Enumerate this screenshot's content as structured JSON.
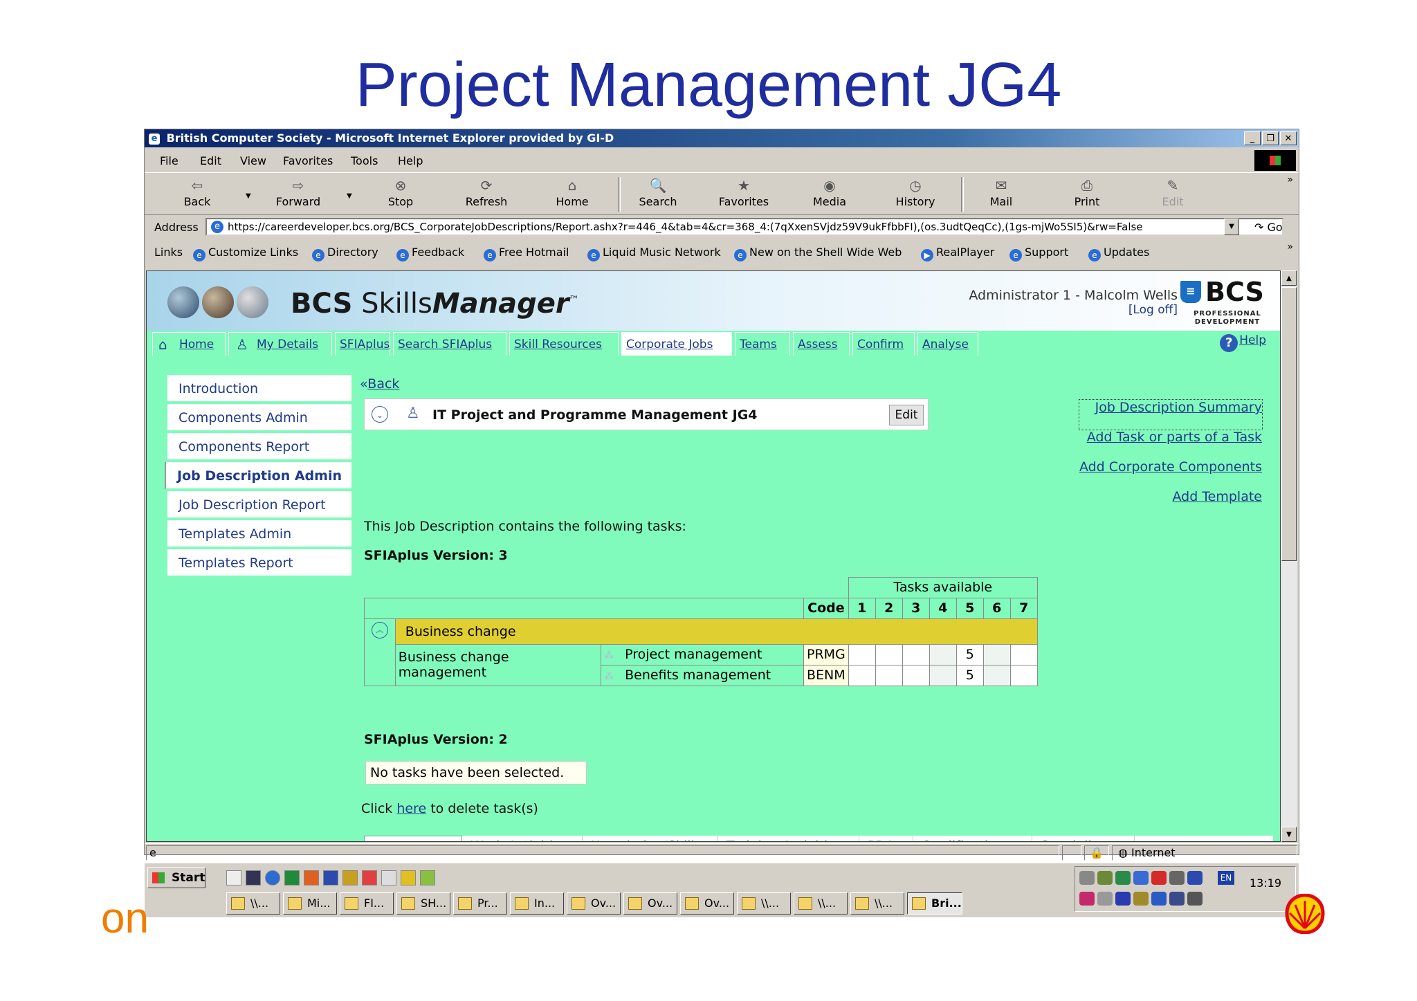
{
  "slide": {
    "title": "Project Management JG4",
    "brand_fragment": "on"
  },
  "window": {
    "title": "British Computer Society - Microsoft Internet Explorer provided by GI-D",
    "menu": [
      "File",
      "Edit",
      "View",
      "Favorites",
      "Tools",
      "Help"
    ],
    "toolbar": {
      "back": "Back",
      "forward": "Forward",
      "stop": "Stop",
      "refresh": "Refresh",
      "home": "Home",
      "search": "Search",
      "favorites": "Favorites",
      "media": "Media",
      "history": "History",
      "mail": "Mail",
      "print": "Print",
      "edit": "Edit"
    },
    "address_label": "Address",
    "address_url": "https://careerdeveloper.bcs.org/BCS_CorporateJobDescriptions/Report.ashx?r=446_4&tab=4&cr=368_4:(7qXxenSVjdz59V9ukFfbbFI),(os.3udtQeqCc),(1gs-mjWo5SI5)&rw=False",
    "go_label": "Go",
    "links_label": "Links",
    "links": [
      "Customize Links",
      "Directory",
      "Feedback",
      "Free Hotmail",
      "Liquid Music Network",
      "New on the Shell Wide Web",
      "RealPlayer",
      "Support",
      "Updates"
    ],
    "status_zone": "Internet"
  },
  "app": {
    "name_bold": "BCS",
    "name_regular": " Skills",
    "name_italic": "Manager",
    "tm": "™",
    "user": "Administrator 1 - Malcolm Wells",
    "logoff": "[Log off]",
    "logo_text": "BCS",
    "logo_subtitle_1": "PROFESSIONAL",
    "logo_subtitle_2": "DEVELOPMENT",
    "nav": [
      "Home",
      "My Details",
      "SFIAplus",
      "Search SFIAplus",
      "Skill Resources",
      "Corporate Jobs",
      "Teams",
      "Assess",
      "Confirm",
      "Analyse"
    ],
    "help": "Help",
    "sidemenu": [
      "Introduction",
      "Components Admin",
      "Components Report",
      "Job Description Admin",
      "Job Description Report",
      "Templates Admin",
      "Templates Report"
    ],
    "back": "Back",
    "jd_title": "IT Project and Programme Management JG4",
    "edit": "Edit",
    "right_links": [
      "Job Description Summary",
      "Add Task or parts of a Task",
      "Add Corporate Components",
      "Add Template"
    ],
    "intro_text": "This Job Description contains the following tasks:",
    "version3_label": "SFIAplus Version: 3",
    "version2_label": "SFIAplus Version: 2",
    "no_tasks": "No tasks have been selected.",
    "delete_prefix": "Click ",
    "delete_link": "here",
    "delete_suffix": " to delete task(s)",
    "bottom_tabs": [
      "Background",
      "Work Activities",
      "Knowledge/Skills",
      "Training Activities",
      "PDAs",
      "Qualifications",
      "Specialisms"
    ]
  },
  "task_table": {
    "tasks_available_label": "Tasks available",
    "code_label": "Code",
    "levels": [
      "1",
      "2",
      "3",
      "4",
      "5",
      "6",
      "7"
    ],
    "category": "Business change",
    "subcategory": "Business change management",
    "rows": [
      {
        "skill": "Project management",
        "code": "PRMG",
        "available": [
          null,
          null,
          null,
          null,
          "5",
          null,
          null
        ]
      },
      {
        "skill": "Benefits management",
        "code": "BENM",
        "available": [
          null,
          null,
          null,
          null,
          "5",
          null,
          null
        ]
      }
    ]
  },
  "taskbar": {
    "start": "Start",
    "clock": "13:19",
    "lang": "EN",
    "buttons": [
      "\\\\...",
      "Mi...",
      "FI...",
      "SH...",
      "Pr...",
      "In...",
      "Ov...",
      "Ov...",
      "Ov...",
      "\\\\...",
      "\\\\...",
      "\\\\...",
      "Bri..."
    ]
  }
}
